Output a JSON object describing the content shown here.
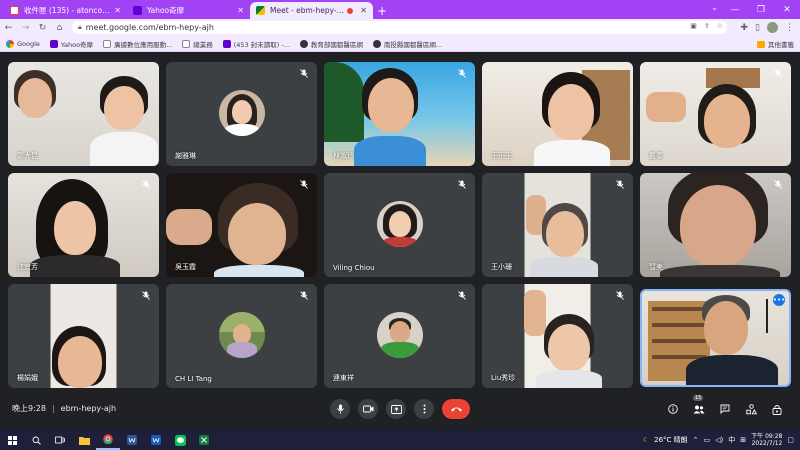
{
  "browser": {
    "tabs": [
      {
        "title": "收件匣 (135) - atoncon12@gm...",
        "favicon": "gmail-icon",
        "active": false
      },
      {
        "title": "Yahoo奇摩",
        "favicon": "yahoo-icon",
        "active": false
      },
      {
        "title": "Meet - ebm-hepy-ajh",
        "favicon": "meet-icon",
        "active": true,
        "recording": true
      }
    ],
    "url": "meet.google.com/ebm-hepy-ajh",
    "bookmarks": [
      {
        "label": "Google",
        "icon": "google-icon"
      },
      {
        "label": "Yahoo奇摩",
        "icon": "yahoo-icon"
      },
      {
        "label": "廣據數位應用服動...",
        "icon": "doc-icon"
      },
      {
        "label": "總業務",
        "icon": "doc-icon"
      },
      {
        "label": "(453 封未讀取) -...",
        "icon": "yahoo-mail-icon"
      },
      {
        "label": "教育部國都醫區網",
        "icon": "globe-icon"
      },
      {
        "label": "南投縣國都醫區網...",
        "icon": "globe-icon"
      }
    ],
    "other_bookmarks": "其他書籤"
  },
  "meet": {
    "participants": [
      {
        "name": "鄭大昆",
        "video": true
      },
      {
        "name": "謝雅琳",
        "video": false
      },
      {
        "name": "林淑玲",
        "video": true
      },
      {
        "name": "王正玉",
        "video": true
      },
      {
        "name": "戴蓁",
        "video": true
      },
      {
        "name": "江宜芳",
        "video": true
      },
      {
        "name": "吳玉霞",
        "video": true
      },
      {
        "name": "Viling Chiou",
        "video": false
      },
      {
        "name": "王小珊",
        "video": true
      },
      {
        "name": "彗美",
        "video": true
      },
      {
        "name": "楊娟娥",
        "video": true
      },
      {
        "name": "CH LI Tang",
        "video": false
      },
      {
        "name": "連東祥",
        "video": false
      },
      {
        "name": "Liu秀珍",
        "video": true
      },
      {
        "name": "",
        "video": true,
        "self": true
      }
    ],
    "time": "晚上9:28",
    "meeting_code": "ebm-hepy-ajh",
    "participant_count": "15"
  },
  "taskbar": {
    "weather": "26°C 晴朗",
    "ime": "中",
    "time": "下午 09:28",
    "date": "2022/7/12"
  },
  "colors": {
    "tab_strip": "#a142f4",
    "toolbar": "#f2eaff",
    "meet_bg": "#202124",
    "tile_bg": "#3c4043",
    "end_call": "#ea4335",
    "taskbar": "#1f1f3a"
  }
}
